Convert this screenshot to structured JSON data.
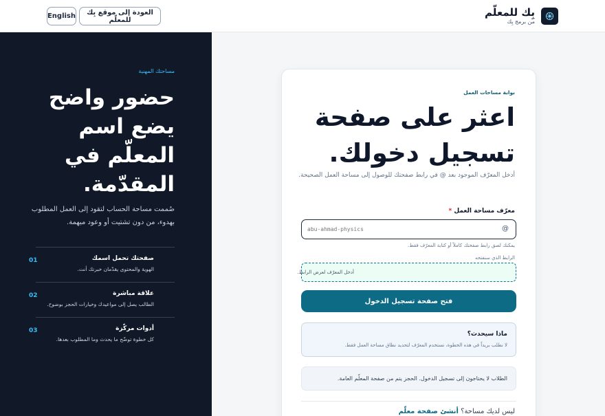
{
  "header": {
    "brand_name": "بِك للمعلّم",
    "brand_tagline": "من برمج بِك",
    "back_label": "العودة إلى موقع بِك للمعلّم",
    "lang_label": "English"
  },
  "sidebar": {
    "eyebrow": "مساحتك المهنية",
    "title": "حضور واضح يضع اسم المعلّم في المقدّمة.",
    "description": "صُممت مساحة الحساب لتقود إلى العمل المطلوب بهدوء، من دون تشتيت أو وعود مبهمة.",
    "items": [
      {
        "num": "01",
        "title": "صفحتك تحمل اسمك",
        "subtitle": "الهوية والمحتوى يقدّمان خبرتك أنت."
      },
      {
        "num": "02",
        "title": "علاقة مباشرة",
        "subtitle": "الطالب يصل إلى مواعيدك وخيارات الحجز بوضوح."
      },
      {
        "num": "03",
        "title": "أدوات مركّزة",
        "subtitle": "كل خطوة توضّح ما يحدث وما المطلوب بعدها."
      }
    ]
  },
  "card": {
    "eyebrow": "بوابة مساحات العمل",
    "title": "اعثر على صفحة تسجيل دخولك.",
    "description": "أدخل المعرّف الموجود بعد @ في رابط صفحتك للوصول إلى مساحة العمل الصحيحة.",
    "field_label": "معرّف مساحة العمل",
    "field_required": "*",
    "field_prefix": "@",
    "field_placeholder": "abu-ahmad-physics",
    "field_help": "يمكنك لصق رابط صفحتك كاملاً أو كتابة المعرّف فقط.",
    "url_label": "الرابط الذي سنفتحه",
    "url_placeholder": "أدخل المعرّف لعرض الرابط.",
    "cta_label": "فتح صفحة تسجيل الدخول",
    "info_title": "ماذا سيحدث؟",
    "info_body": "لا نطلب بريداً في هذه الخطوة، نستخدم المعرّف لتحديد نطاق مساحة العمل فقط.",
    "note": "الطلاب لا يحتاجون إلى تسجيل الدخول. الحجز يتم من صفحة المعلّم العامة.",
    "footer_prompt": "ليس لديك مساحة؟",
    "footer_link": "أنشئ صفحة معلّم"
  },
  "colors": {
    "accent": "#0e6b85",
    "dark_panel": "#111827",
    "accent_light": "#38bdf8"
  }
}
